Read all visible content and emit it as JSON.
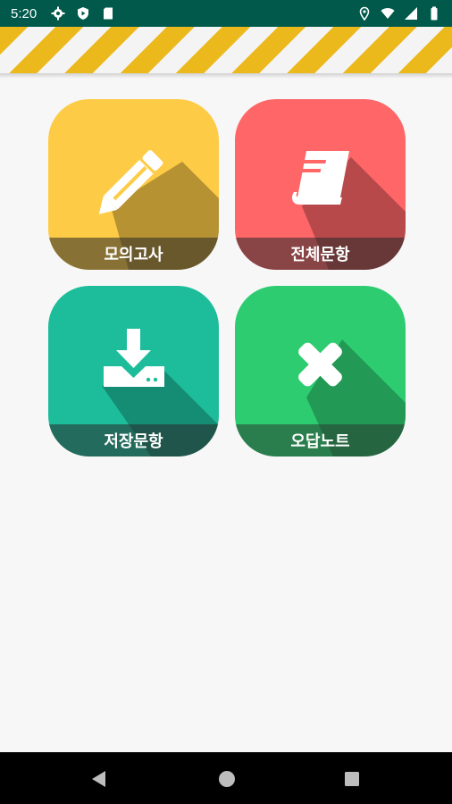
{
  "status_bar": {
    "time": "5:20",
    "left_icons": [
      "gear-icon",
      "shield-play-icon",
      "sd-card-icon"
    ],
    "right_icons": [
      "location-icon",
      "wifi-icon",
      "signal-icon",
      "battery-icon"
    ]
  },
  "menu": {
    "mock_exam_label": "모의고사",
    "all_questions_label": "전체문항",
    "saved_questions_label": "저장문항",
    "wrong_answer_note_label": "오답노트"
  },
  "colors": {
    "status_bar": "#00594a",
    "stripe_yellow": "#ecb91c",
    "tile_mock": "#fdcb46",
    "tile_all": "#fe6668",
    "tile_saved": "#1dbd9b",
    "tile_wrong": "#2ecc70"
  },
  "nav_bar": {
    "buttons": [
      "back-icon",
      "home-icon",
      "recents-icon"
    ]
  }
}
